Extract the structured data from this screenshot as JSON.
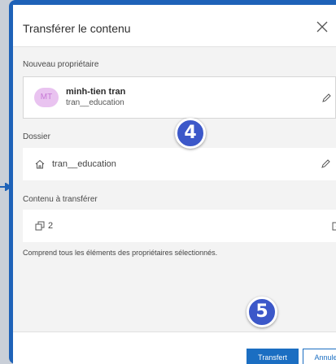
{
  "dialog": {
    "title": "Transférer le contenu",
    "close_icon": "close-icon"
  },
  "owner": {
    "label": "Nouveau propriétaire",
    "initials": "MT",
    "name": "minh-tien tran",
    "username": "tran__education",
    "edit_icon": "pencil-icon"
  },
  "folder": {
    "label": "Dossier",
    "home_icon": "home-icon",
    "name": "tran__education",
    "edit_icon": "pencil-icon"
  },
  "content": {
    "label": "Contenu à transférer",
    "stack_icon": "stack-icon",
    "count": "2",
    "open_icon": "open-external-icon"
  },
  "note": "Comprend tous les éléments des propriétaires sélectionnés.",
  "footer": {
    "transfer_label": "Transfert",
    "cancel_label": "Annuler"
  },
  "annotations": {
    "step4": "4",
    "step5": "5"
  },
  "colors": {
    "accent": "#1b6ec2",
    "step_badge": "#3c58c9",
    "avatar_bg": "#e9c3f0",
    "frame": "#1e62b8"
  }
}
